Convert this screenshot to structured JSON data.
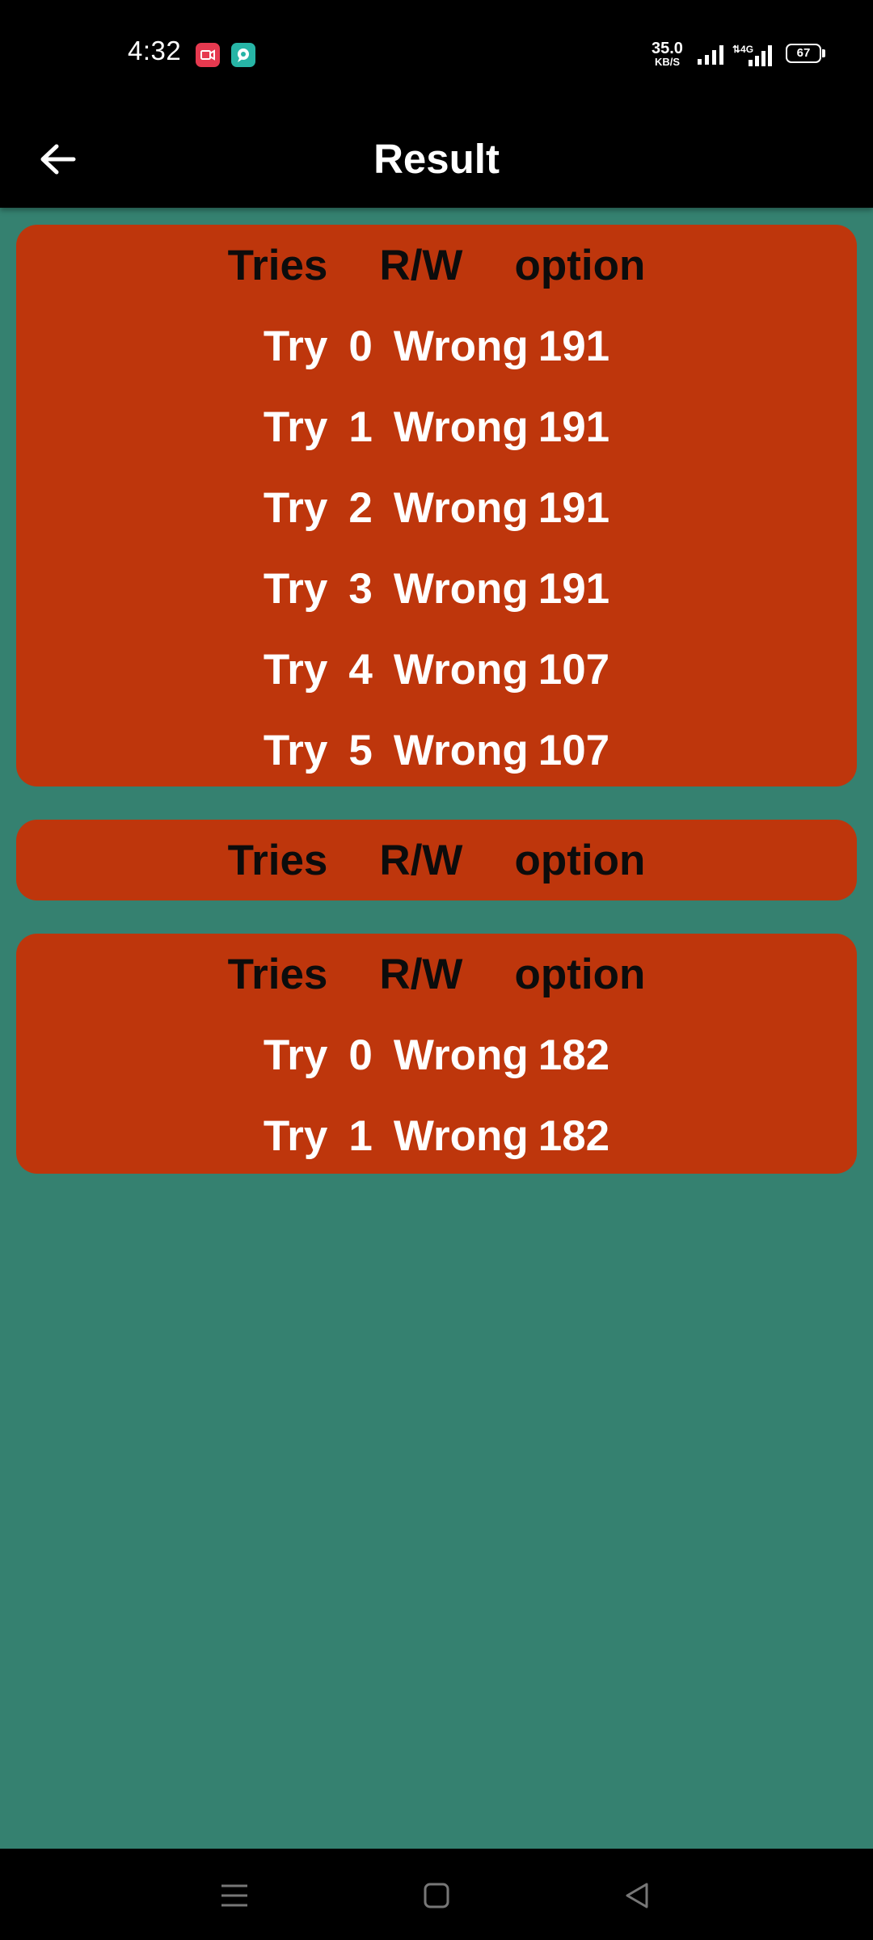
{
  "colors": {
    "background": "#358170",
    "card": "#be360c",
    "bars": "#000000"
  },
  "status_bar": {
    "time": "4:32",
    "net_speed": "35.0",
    "net_unit": "KB/S",
    "battery": "67",
    "icons": [
      "screen-record-icon",
      "chat-icon",
      "signal-icon",
      "4g-signal-icon",
      "battery-icon"
    ]
  },
  "app_bar": {
    "title": "Result",
    "back_icon": "arrow-left-icon"
  },
  "headers": {
    "tries": "Tries",
    "rw": "R/W",
    "option": "option"
  },
  "results": [
    {
      "rows": [
        {
          "label": "Try",
          "index": "0",
          "rw": "Wrong",
          "option": "191"
        },
        {
          "label": "Try",
          "index": "1",
          "rw": "Wrong",
          "option": "191"
        },
        {
          "label": "Try",
          "index": "2",
          "rw": "Wrong",
          "option": "191"
        },
        {
          "label": "Try",
          "index": "3",
          "rw": "Wrong",
          "option": "191"
        },
        {
          "label": "Try",
          "index": "4",
          "rw": "Wrong",
          "option": "107"
        },
        {
          "label": "Try",
          "index": "5",
          "rw": "Wrong",
          "option": "107"
        }
      ]
    },
    {
      "rows": []
    },
    {
      "rows": [
        {
          "label": "Try",
          "index": "0",
          "rw": "Wrong",
          "option": "182"
        },
        {
          "label": "Try",
          "index": "1",
          "rw": "Wrong",
          "option": "182"
        }
      ]
    }
  ],
  "nav_bar": {
    "icons": [
      "menu-icon",
      "home-icon",
      "back-triangle-icon"
    ]
  }
}
